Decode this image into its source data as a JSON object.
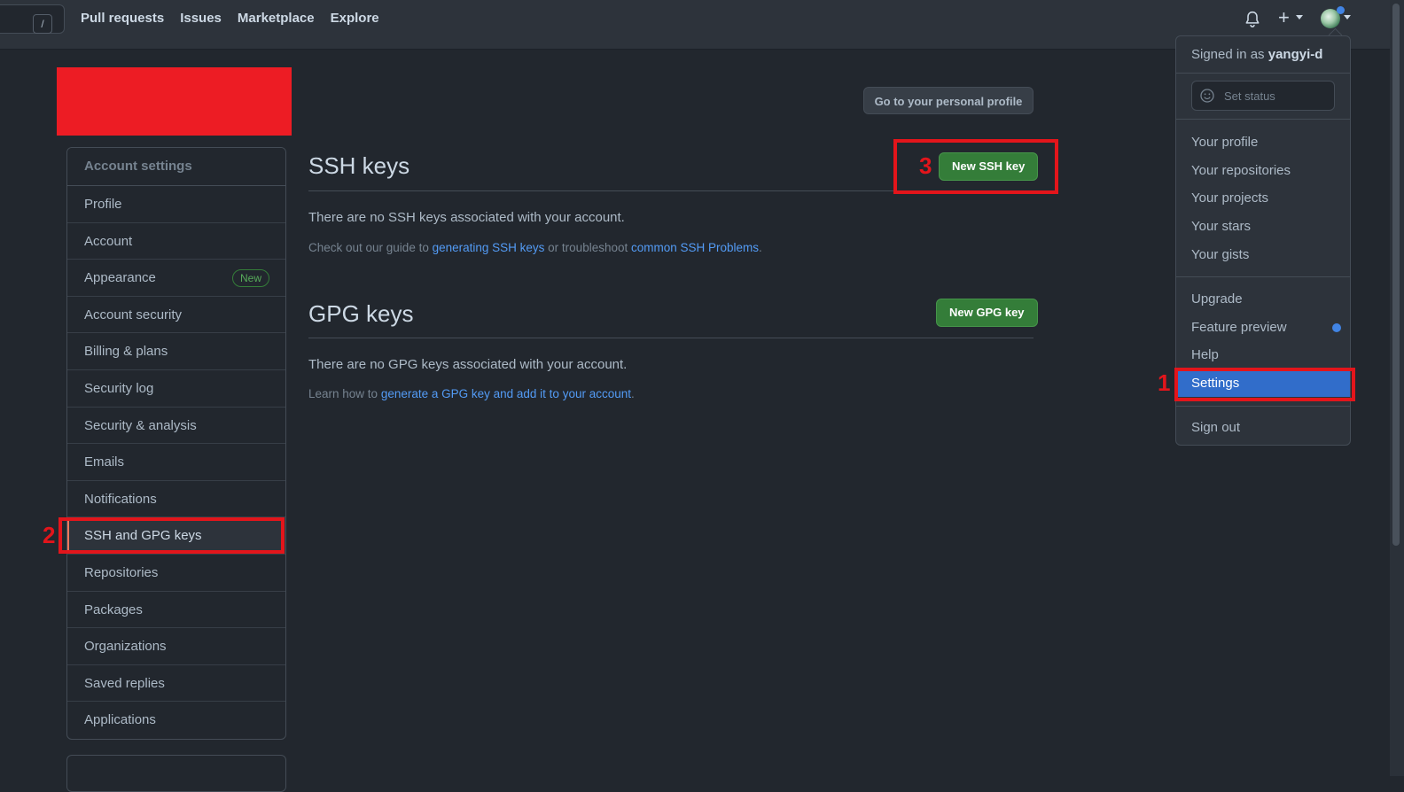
{
  "header": {
    "search_shortcut": "/",
    "nav": [
      "Pull requests",
      "Issues",
      "Marketplace",
      "Explore"
    ],
    "icons": [
      "bell-icon",
      "plus-icon",
      "avatar"
    ]
  },
  "sidebar": {
    "heading": "Account settings",
    "items": [
      {
        "label": "Profile"
      },
      {
        "label": "Account"
      },
      {
        "label": "Appearance",
        "badge": "New"
      },
      {
        "label": "Account security"
      },
      {
        "label": "Billing & plans"
      },
      {
        "label": "Security log"
      },
      {
        "label": "Security & analysis"
      },
      {
        "label": "Emails"
      },
      {
        "label": "Notifications"
      },
      {
        "label": "SSH and GPG keys",
        "selected": true
      },
      {
        "label": "Repositories"
      },
      {
        "label": "Packages"
      },
      {
        "label": "Organizations"
      },
      {
        "label": "Saved replies"
      },
      {
        "label": "Applications"
      }
    ]
  },
  "main": {
    "profile_button": "Go to your personal profile",
    "ssh": {
      "title": "SSH keys",
      "button": "New SSH key",
      "empty": "There are no SSH keys associated with your account.",
      "note_prefix": "Check out our guide to ",
      "note_link1": "generating SSH keys",
      "note_middle": " or troubleshoot ",
      "note_link2": "common SSH Problems",
      "note_suffix": "."
    },
    "gpg": {
      "title": "GPG keys",
      "button": "New GPG key",
      "empty": "There are no GPG keys associated with your account.",
      "note_prefix": "Learn how to ",
      "note_link": "generate a GPG key and add it to your account",
      "note_suffix": "."
    }
  },
  "dropdown": {
    "signed_in_prefix": "Signed in as ",
    "username": "yangyi-d",
    "status_placeholder": "Set status",
    "items1": [
      "Your profile",
      "Your repositories",
      "Your projects",
      "Your stars",
      "Your gists"
    ],
    "items2": [
      "Upgrade",
      "Feature preview",
      "Help",
      "Settings"
    ],
    "active_item": "Settings",
    "sign_out": "Sign out"
  },
  "annotations": [
    "1",
    "2",
    "3"
  ],
  "colors": {
    "background": "#22272e",
    "header": "#2d333b",
    "green_button": "#347d39",
    "link": "#539bf5",
    "highlight": "#316dca",
    "annotation_red": "#e3151b",
    "redaction": "#ed1c24"
  }
}
